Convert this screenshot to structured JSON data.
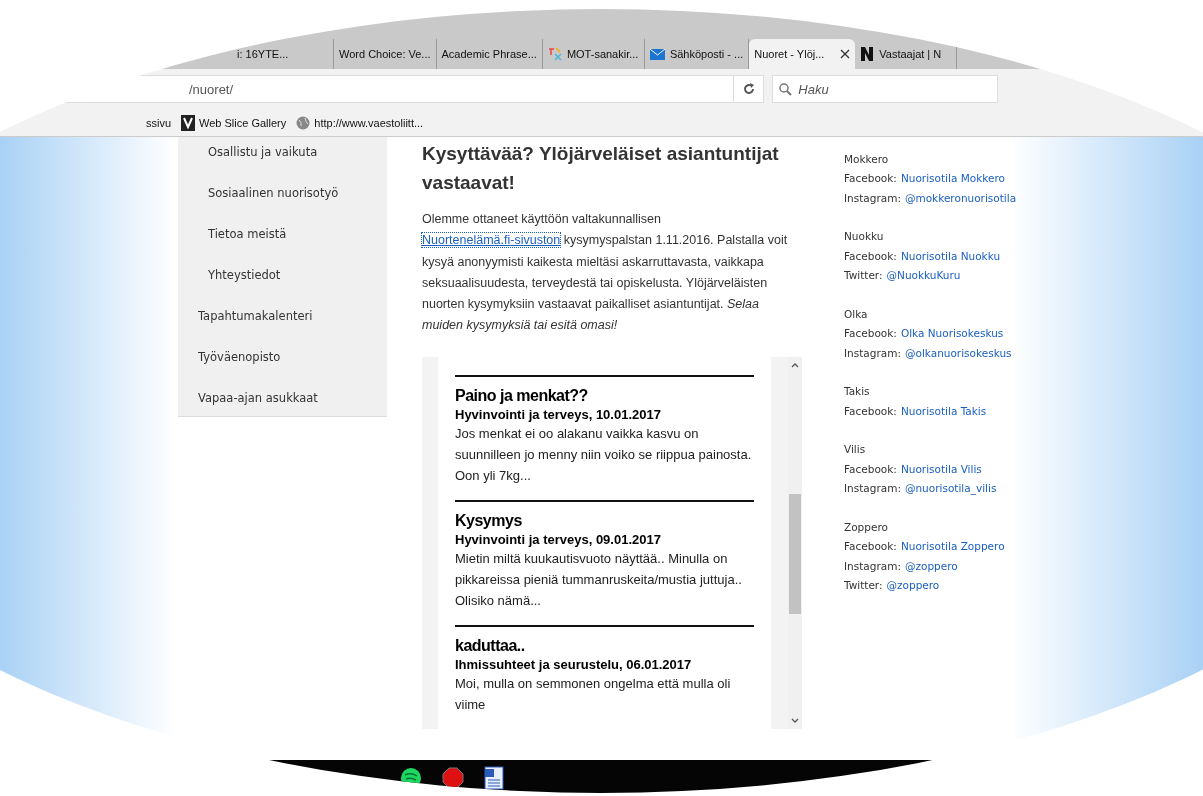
{
  "tabs": [
    {
      "label": "i: 16YTE...",
      "selected": false
    },
    {
      "label": "Word Choice: Ve...",
      "selected": false
    },
    {
      "label": "Academic Phrase...",
      "selected": false
    },
    {
      "label": "MOT-sanakir...",
      "kind": "mot",
      "selected": false
    },
    {
      "label": "Sähköposti - ...",
      "kind": "mail",
      "selected": false
    },
    {
      "label": "Nuoret - Ylöj...",
      "selected": true
    },
    {
      "label": "Vastaajat | N",
      "kind": "n",
      "selected": false
    }
  ],
  "address_bar": {
    "value": "/nuoret/"
  },
  "search": {
    "placeholder": "Haku"
  },
  "bookmarks": [
    {
      "label": "ssivu"
    },
    {
      "label": "Web Slice Gallery",
      "kind": "slice"
    },
    {
      "label": "http://www.vaestoliitt...",
      "kind": "globe"
    }
  ],
  "sidebar": {
    "subitems": [
      "Osallistu ja vaikuta",
      "Sosiaalinen nuorisotyö",
      "Tietoa meistä",
      "Yhteystiedot"
    ],
    "items": [
      "Tapahtumakalenteri",
      "Työväenopisto",
      "Vapaa-ajan asukkaat"
    ]
  },
  "article": {
    "heading": "Kysyttävää? Ylöjärveläiset asiantuntijat vastaavat!",
    "intro_before": "Olemme ottaneet käyttöön valtakunnallisen",
    "intro_link": "Nuortenelämä.fi-sivuston",
    "intro_after": "kysymyspalstan 1.11.2016. Palstalla voit kysyä anonyymisti kaikesta mieltäsi askarruttavasta, vaikkapa seksuaalisuudesta, terveydestä tai opiskelusta. Ylöjärveläisten nuorten kysymyksiin vastaavat paikalliset asiantuntijat. *Selaa muiden kysymyksiä tai esitä omasi!*"
  },
  "questions": [
    {
      "title": "Paino ja menkat??",
      "meta": "Hyvinvointi ja terveys, 10.01.2017",
      "excerpt": "Jos menkat ei oo alakanu vaikka kasvu on suunnilleen jo menny niin voiko se riippua painosta. Oon yli 7kg..."
    },
    {
      "title": "Kysymys",
      "meta": "Hyvinvointi ja terveys, 09.01.2017",
      "excerpt": "Mietin miltä kuukautisvuoto näyttää.. Minulla on pikkareissa pieniä tummanruskeita/mustia juttuja.. Olisiko nämä..."
    },
    {
      "title": "kaduttaa..",
      "meta": "Ihmissuhteet ja seurustelu, 06.01.2017",
      "excerpt": "Moi, mulla on semmonen ongelma että mulla oli viime"
    }
  ],
  "contacts": [
    {
      "name": "Mokkero",
      "links": [
        {
          "label": "Facebook:",
          "link": "Nuorisotila Mokkero"
        },
        {
          "label": "Instagram:",
          "link": "@mokkeronuorisotila"
        }
      ]
    },
    {
      "name": "Nuokku",
      "links": [
        {
          "label": "Facebook:",
          "link": "Nuorisotila Nuokku"
        },
        {
          "label": "Twitter:",
          "link": "@NuokkuKuru"
        }
      ]
    },
    {
      "name": "Olka",
      "links": [
        {
          "label": "Facebook:",
          "link": "Olka Nuorisokeskus"
        },
        {
          "label": "Instagram:",
          "link": "@olkanuorisokeskus"
        }
      ]
    },
    {
      "name": "Takis",
      "links": [
        {
          "label": "Facebook:",
          "link": "Nuorisotila Takis"
        }
      ]
    },
    {
      "name": "Vilis",
      "links": [
        {
          "label": "Facebook:",
          "link": "Nuorisotila Vilis"
        },
        {
          "label": "Instagram:",
          "link": "@nuorisotila_vilis"
        }
      ]
    },
    {
      "name": "Zoppero",
      "links": [
        {
          "label": "Facebook:",
          "link": "Nuorisotila Zoppero"
        },
        {
          "label": "Instagram:",
          "link": "@zoppero"
        },
        {
          "label": "Twitter:",
          "link": "@zoppero"
        }
      ]
    }
  ],
  "taskbar": [
    {
      "kind": "circle"
    },
    {
      "kind": "hexagon"
    },
    {
      "kind": "document"
    }
  ]
}
